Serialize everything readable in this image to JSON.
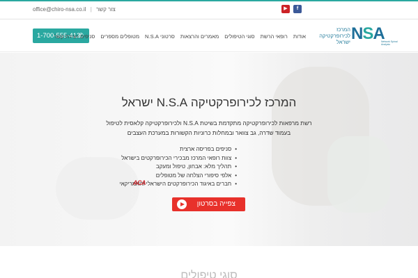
{
  "topbar": {
    "email": "office@chiro-nsa.co.il",
    "separator": "|",
    "contact_link": "צור קשר",
    "social": [
      {
        "name": "youtube",
        "glyph": "▶"
      },
      {
        "name": "facebook",
        "glyph": "f"
      }
    ]
  },
  "header": {
    "phone": "1-700-555-412",
    "phone_icon": "phone-icon",
    "nav": [
      "אודות",
      "רופאי הרשת",
      "סוגי הטיפולים",
      "מאמרים והרצאות",
      "סרטוני N.S.A",
      "מטופלים מספרים",
      "סניפים ויצירת קשר"
    ],
    "logo": {
      "line1": "המרכז",
      "line2": "לכירופרקטיקה",
      "line3": "ישראל",
      "mark_n": "N",
      "mark_s": "S",
      "mark_a": "A",
      "subtitle": "Network Spinal Analysis"
    }
  },
  "hero": {
    "title": "המרכז לכירופרקטיקה N.S.A ישראל",
    "description": "רשת מרפאות לכירופרקטיקה מתקדמת בשיטת N.S.A ולכירופרקטיקה קלאסית לטיפול בעמוד שדרה, גב צוואר ובמחלות כרוניות הקשורות במערכת העצבים",
    "bullets": [
      "סניפים בפריסה ארצית",
      "צוות רופאי המרכז מבכירי הכירופרקטים בישראל",
      "תהליך מלא: אבחון, טיפול ומעקב",
      "אלפי סיפורי הצלחה של מטופלים",
      "חברים באיגוד הכירופרקטים הישראלי והאמריקאי"
    ],
    "aca_logo": "ACA",
    "video_button": "צפייה בסרטון"
  },
  "section": {
    "title": "סוגי טיפולים"
  }
}
